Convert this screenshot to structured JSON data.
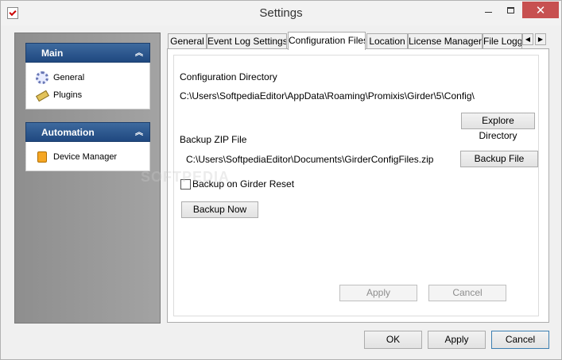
{
  "window": {
    "title": "Settings"
  },
  "sidebar": {
    "groups": [
      {
        "title": "Main",
        "items": [
          {
            "label": "General",
            "icon": "gear-icon"
          },
          {
            "label": "Plugins",
            "icon": "plug-icon"
          }
        ]
      },
      {
        "title": "Automation",
        "items": [
          {
            "label": "Device Manager",
            "icon": "device-icon"
          }
        ]
      }
    ]
  },
  "tabs": [
    {
      "label": "General"
    },
    {
      "label": "Event Log Settings"
    },
    {
      "label": "Configuration Files",
      "active": true
    },
    {
      "label": "Location"
    },
    {
      "label": "License Manager"
    },
    {
      "label": "File Logg"
    }
  ],
  "config": {
    "dir_label": "Configuration Directory",
    "dir_path": "C:\\Users\\SoftpediaEditor\\AppData\\Roaming\\Promixis\\Girder\\5\\Config\\",
    "explore_button": "Explore Directory",
    "zip_label": "Backup ZIP File",
    "zip_path": "C:\\Users\\SoftpediaEditor\\Documents\\GirderConfigFiles.zip",
    "backup_file_button": "Backup File",
    "checkbox_label": "Backup on Girder Reset",
    "checkbox_checked": false,
    "backup_now_button": "Backup Now",
    "apply_inner": "Apply",
    "cancel_inner": "Cancel"
  },
  "footer": {
    "ok": "OK",
    "apply": "Apply",
    "cancel": "Cancel"
  },
  "watermark": "SOFTPEDIA"
}
